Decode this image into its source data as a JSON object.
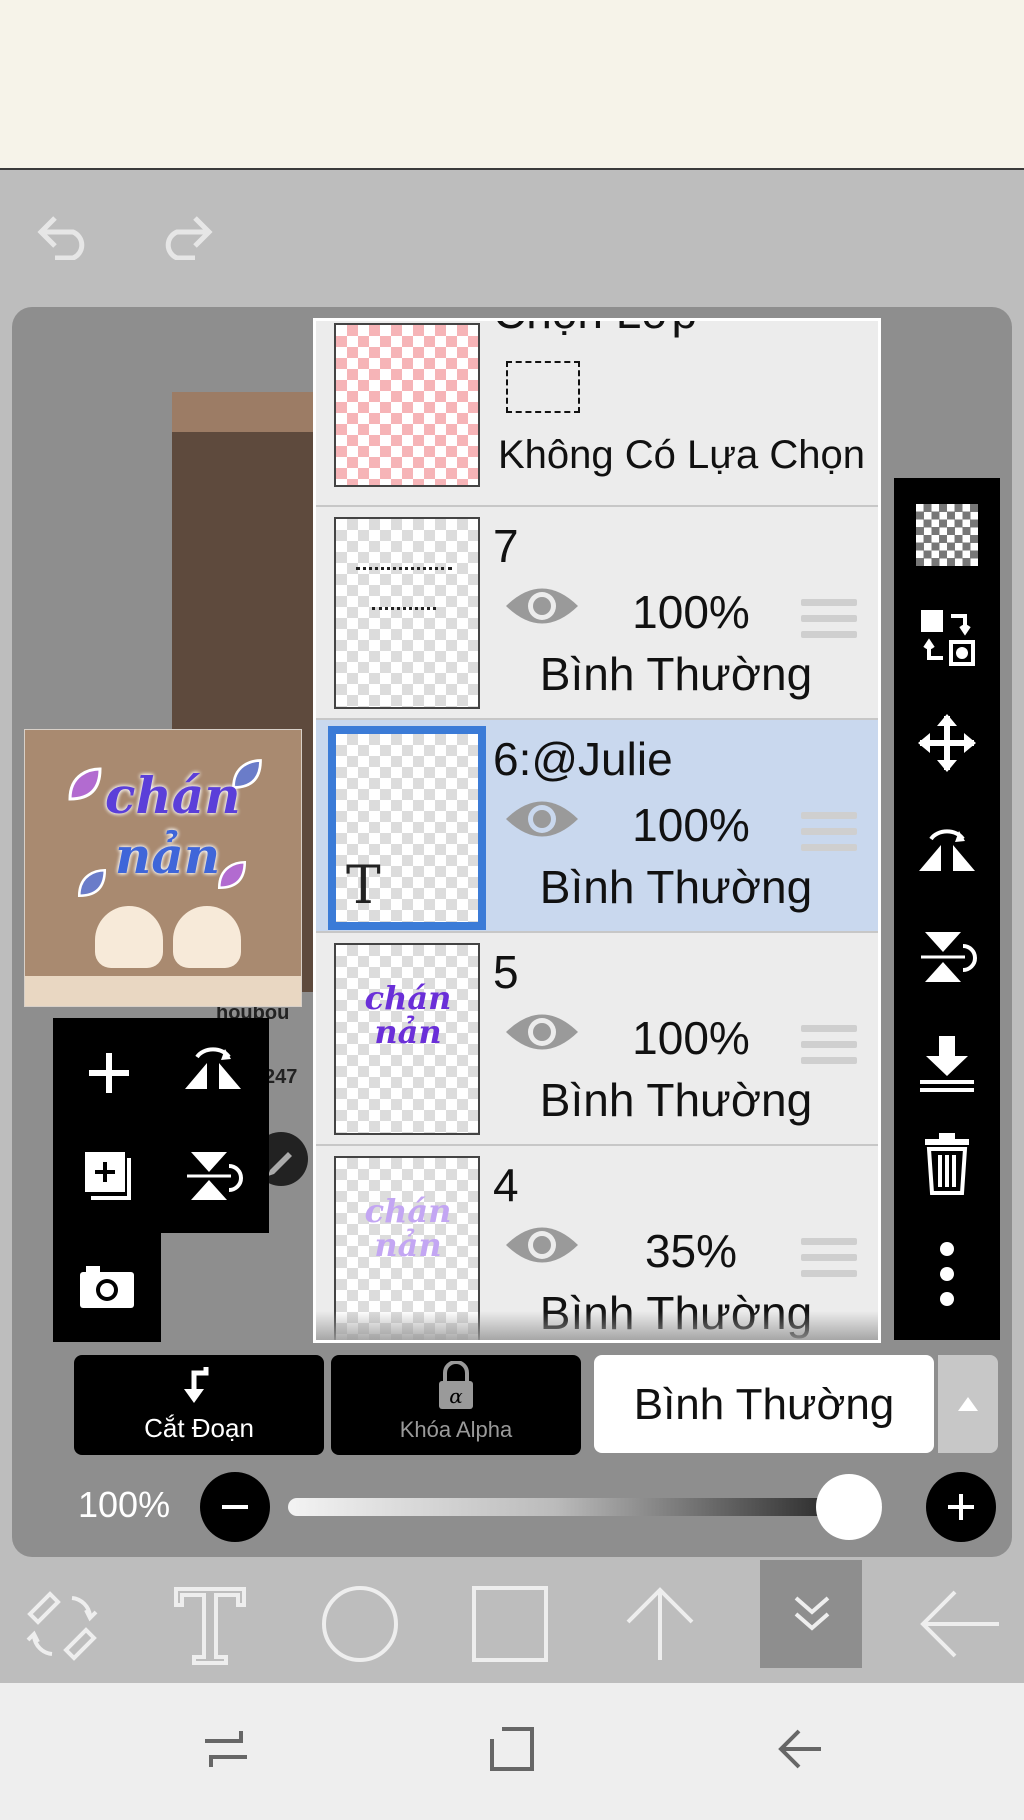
{
  "layers_panel": {
    "top_layer": {
      "title": "Chọn Lớp",
      "subtitle": "Không Có Lựa Chọn"
    },
    "layers": [
      {
        "name": "7",
        "opacity": "100%",
        "blend": "Bình Thường"
      },
      {
        "name": "6:@Julie",
        "opacity": "100%",
        "blend": "Bình Thường",
        "text_badge": "T"
      },
      {
        "name": "5",
        "opacity": "100%",
        "blend": "Bình Thường",
        "thumb_text": "chán nản"
      },
      {
        "name": "4",
        "opacity": "35%",
        "blend": "Bình Thường",
        "thumb_text": "chán nản"
      }
    ]
  },
  "preview": {
    "art_text_line1": "chán",
    "art_text_line2": "nản"
  },
  "canvas": {
    "partial_text_1": "houbou",
    "partial_text_2": "247"
  },
  "bottom_controls": {
    "clip_label": "Cắt Đoạn",
    "alpha_lock_label": "Khóa Alpha",
    "blend_mode": "Bình Thường",
    "opacity_label": "100%",
    "opacity_value": 1.0
  },
  "colors": {
    "selected_row": "#c9d8ee",
    "selection_border": "#3b7bd7",
    "panel_black": "#000000",
    "workspace": "#8e8e8e"
  }
}
